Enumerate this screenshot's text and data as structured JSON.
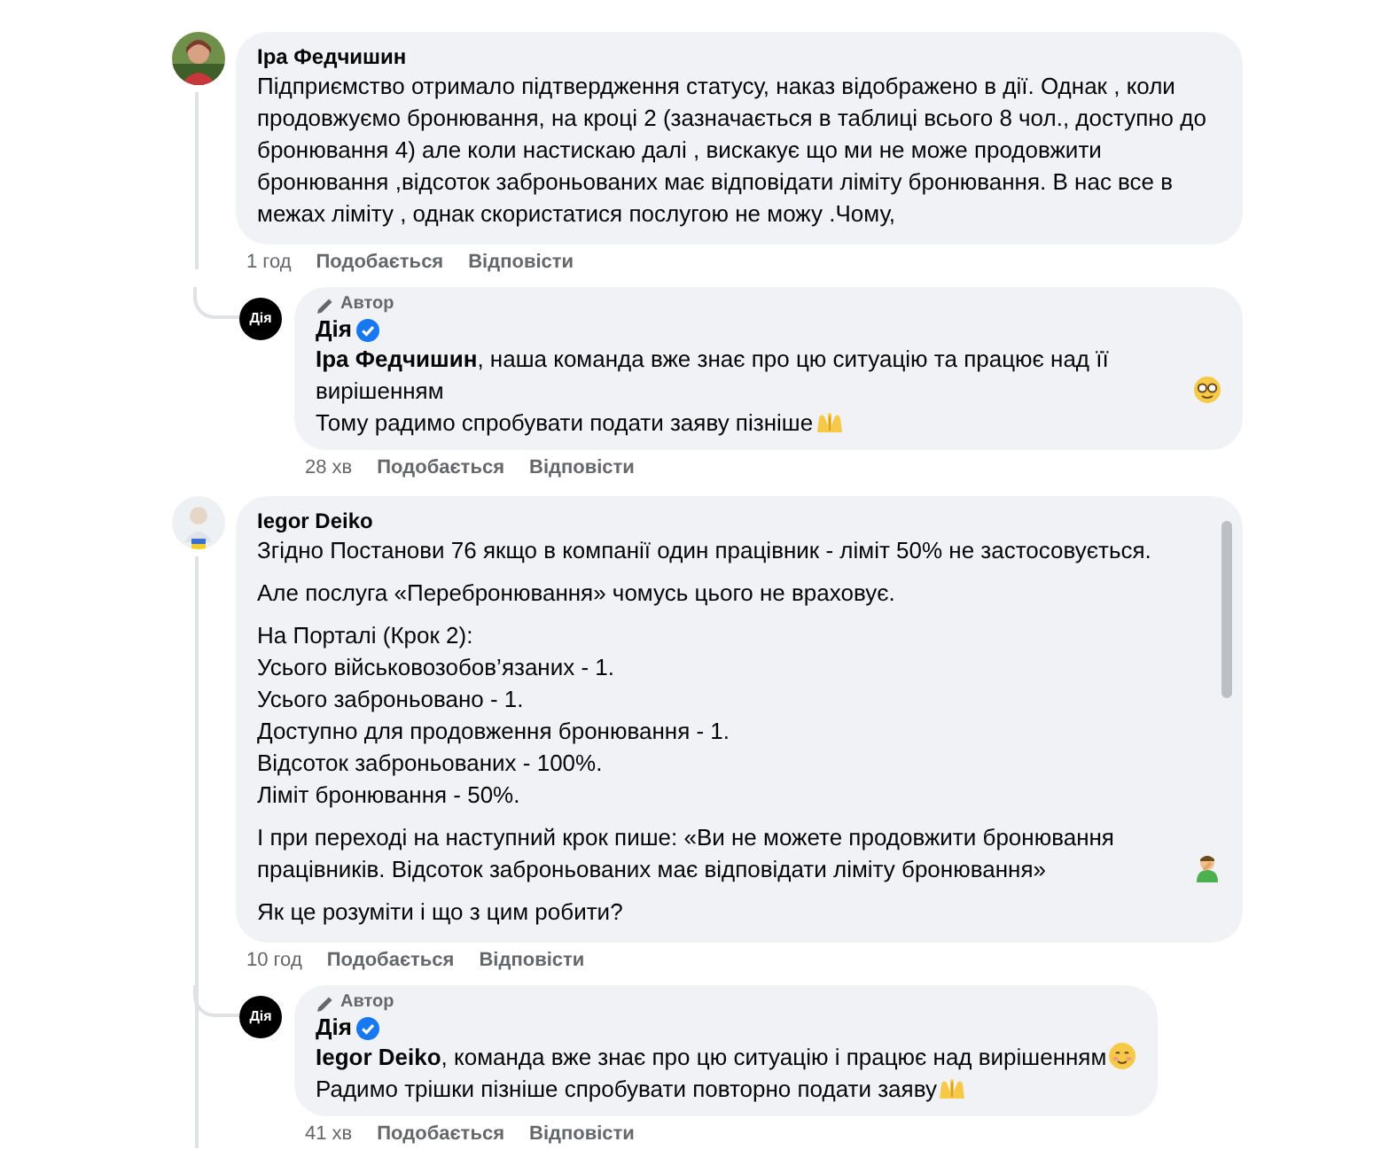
{
  "comments": [
    {
      "author": "Іра Федчишин",
      "avatar": {
        "kind": "picture"
      },
      "paragraphs": [
        [
          {
            "text": "Підприємство отримало підтвердження статусу, наказ відображено в дії. Однак , коли продовжуємо бронювання, на кроці 2 (зазначається в таблиці всього 8 чол., доступно до бронювання 4) але коли настискаю далі , вискакує що ми не може продовжити бронювання ,відсоток заброньованих має відповідати ліміту бронювання. В нас все в межах ліміту , однак скористатися послугою не можу .Чому,"
          }
        ]
      ],
      "time": "1 год",
      "actions": [
        "Подобається",
        "Відповісти"
      ],
      "thread_continues": false,
      "replies": [
        {
          "badge": "Автор",
          "author": "Дія",
          "verified": true,
          "avatar_text": "Дія",
          "paragraphs": [
            [
              {
                "text": "**Іра Федчишин**, наша команда вже знає про цю ситуацію та працює над її вирішенням",
                "kind": "glasses"
              },
              {
                "text": "Тому радимо спробувати подати заяву пізніше",
                "kind": "hands"
              }
            ]
          ],
          "time": "28 хв",
          "actions": [
            "Подобається",
            "Відповісти"
          ]
        }
      ]
    },
    {
      "author": "Iegor Deiko",
      "avatar": {
        "kind": "picture"
      },
      "paragraphs": [
        [
          {
            "text": "Згідно Постанови 76 якщо в компанії один працівник - ліміт 50% не застосовується."
          }
        ],
        [
          {
            "text": "Але послуга «Перебронювання» чомусь цього не враховує."
          }
        ],
        [
          {
            "text": "На Порталі (Крок 2):"
          },
          {
            "text": "Усього військовозобов’язаних - 1."
          },
          {
            "text": "Усього заброньовано - 1."
          },
          {
            "text": "Доступно для продовження бронювання - 1."
          },
          {
            "text": "Відсоток заброньованих - 100%."
          },
          {
            "text": "Ліміт бронювання - 50%."
          }
        ],
        [
          {
            "text": "І при переході на наступний крок пише: «Ви не можете продовжити бронювання працівників. Відсоток заброньованих має відповідати ліміту бронювання»",
            "kind": "facepalm"
          }
        ],
        [
          {
            "text": "Як це розуміти і що з цим робити?"
          }
        ]
      ],
      "time": "10 год",
      "actions": [
        "Подобається",
        "Відповісти"
      ],
      "thread_continues": true,
      "replies": [
        {
          "badge": "Автор",
          "author": "Дія",
          "verified": true,
          "avatar_text": "Дія",
          "paragraphs": [
            [
              {
                "text": "**Iegor Deiko**, команда вже знає про цю ситуацію і працює над вирішенням",
                "kind": "smile"
              },
              {
                "text": "Радимо трішки пізніше спробувати повторно подати заяву",
                "kind": "hands"
              }
            ]
          ],
          "time": "41 хв",
          "actions": [
            "Подобається",
            "Відповісти"
          ]
        }
      ]
    }
  ]
}
